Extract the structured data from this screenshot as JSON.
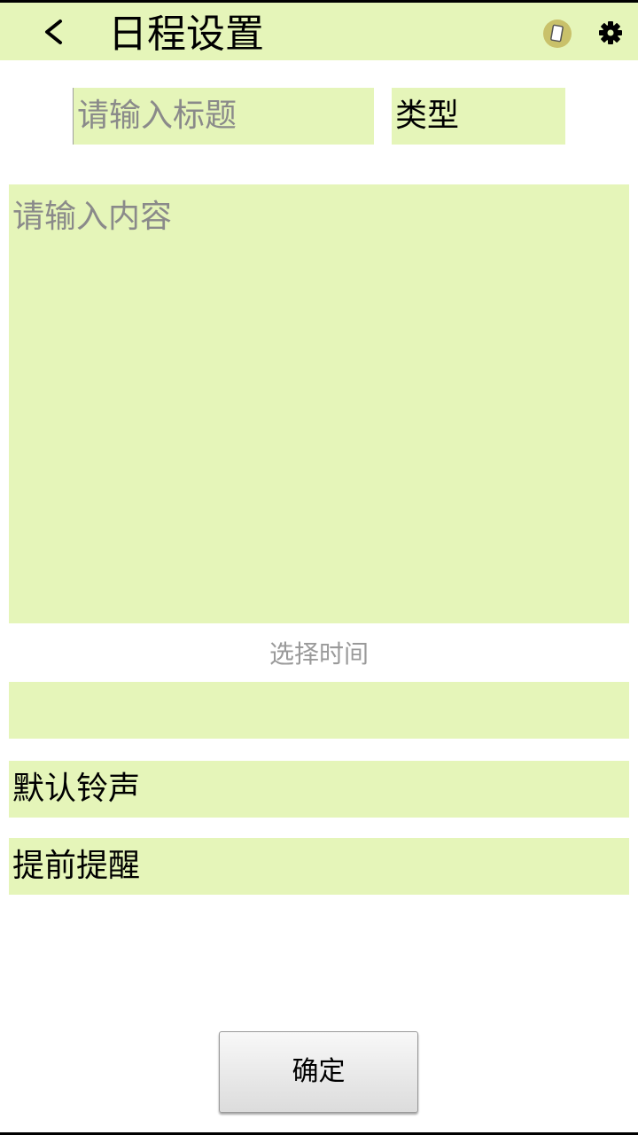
{
  "header": {
    "title": "日程设置",
    "back_icon": "chevron-left-icon",
    "phone_icon": "phone-icon",
    "settings_icon": "gear-icon"
  },
  "form": {
    "title_placeholder": "请输入标题",
    "type_label": "类型",
    "content_placeholder": "请输入内容",
    "choose_time_label": "选择时间",
    "time_value": "",
    "ringtone_label": "默认铃声",
    "reminder_label": "提前提醒"
  },
  "actions": {
    "confirm_label": "确定"
  },
  "colors": {
    "field_background": "#e5f5b9",
    "placeholder_text": "#8a8a8a",
    "phone_icon_background": "#c9c16a"
  }
}
